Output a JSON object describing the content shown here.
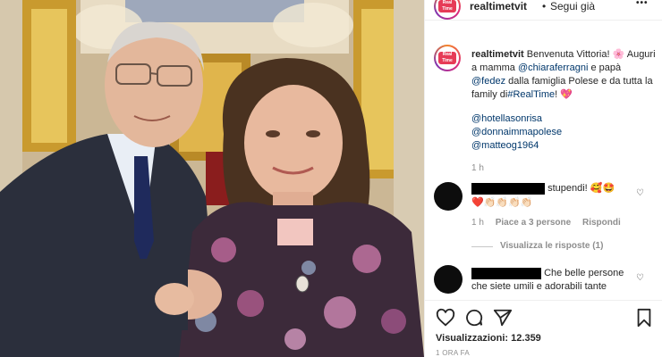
{
  "header": {
    "username": "realtimetvit",
    "separator": "•",
    "follow_label": "Segui già",
    "more_label": "•••"
  },
  "brand_logo": {
    "line1": "Real",
    "line2": "Time",
    "line3": "Canale 31"
  },
  "caption": {
    "username": "realtimetvit",
    "text_1": "Benvenuta Vittoria! 🌸",
    "text_2": "Auguri a mamma",
    "mention_1": "@chiaraferragni",
    "text_3": "e papà",
    "mention_2": "@fedez",
    "text_4": "dalla famiglia Polese e da tutta la family di",
    "hashtag": "#RealTime",
    "text_5": "! 💖",
    "mention_3": "@hotellasonrisa",
    "mention_4": "@donnaimmapolese",
    "mention_5": "@matteog1964",
    "time": "1 h"
  },
  "comments": [
    {
      "text": "stupendi! 🥰🤩",
      "text_2": "❤️👏🏻👏🏻👏🏻👏🏻",
      "time": "1 h",
      "likes": "Piace a 3 persone",
      "reply": "Rispondi",
      "view_replies": "Visualizza le risposte (1)"
    },
    {
      "text": "Che belle persone",
      "text_2": "che siete umili e adorabili tante"
    }
  ],
  "stats": {
    "views_label": "Visualizzazioni:",
    "views_value": "12.359",
    "posted": "1 ORA FA"
  },
  "colors": {
    "accent": "#00376b",
    "muted": "#8e8e8e",
    "border": "#efefef"
  }
}
